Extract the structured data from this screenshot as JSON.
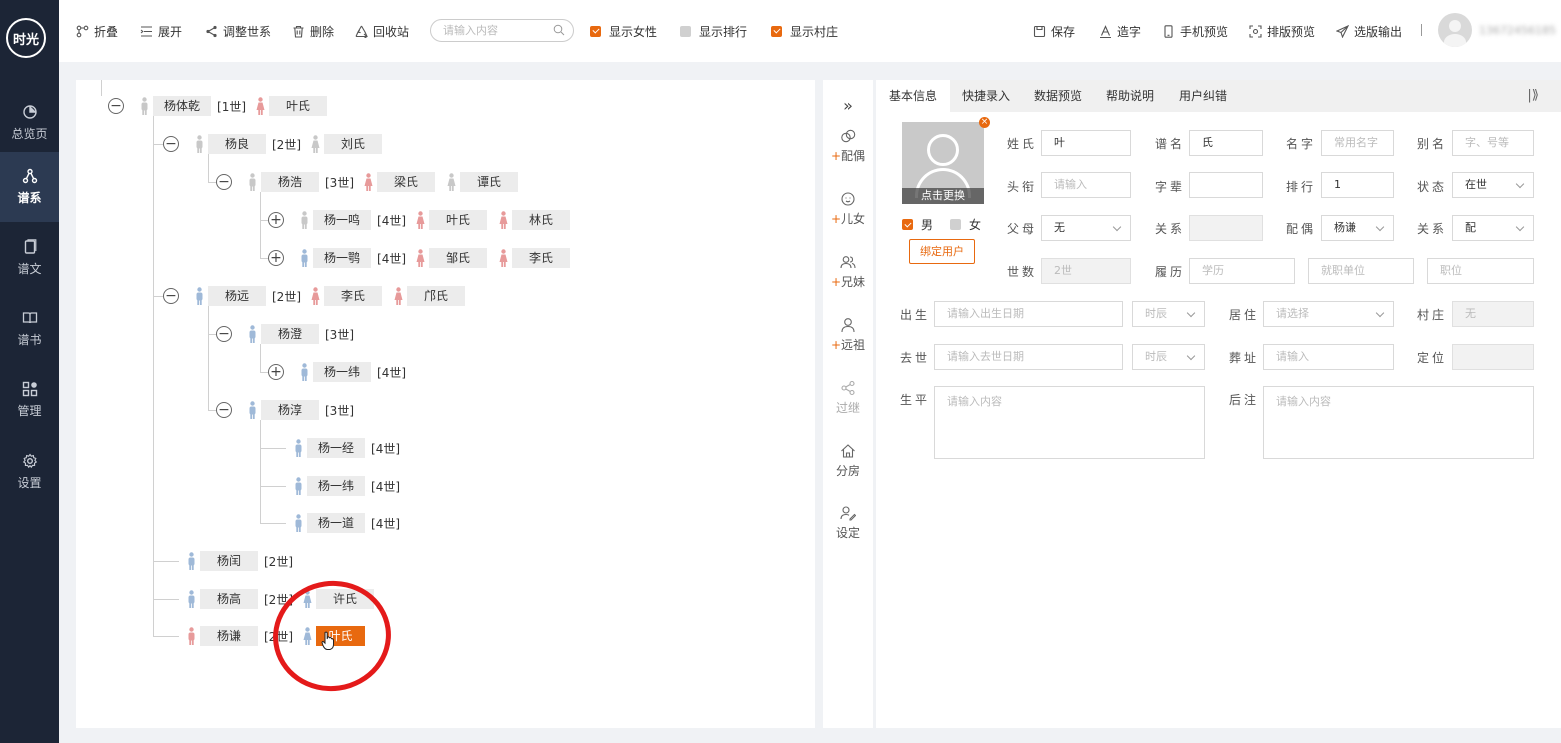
{
  "sidebar": {
    "logo": "时光",
    "items": [
      {
        "label": "总览页",
        "icon": "pie-chart-icon",
        "active": false
      },
      {
        "label": "谱系",
        "icon": "tree-icon",
        "active": true
      },
      {
        "label": "谱文",
        "icon": "document-icon",
        "active": false
      },
      {
        "label": "谱书",
        "icon": "book-icon",
        "active": false
      },
      {
        "label": "管理",
        "icon": "grid-icon",
        "active": false
      },
      {
        "label": "设置",
        "icon": "gear-icon",
        "active": false
      }
    ]
  },
  "toolbar": {
    "fold": "折叠",
    "expand": "展开",
    "adjust": "调整世系",
    "delete": "删除",
    "recycle": "回收站",
    "search_placeholder": "请输入内容",
    "show_female": "显示女性",
    "show_rank": "显示排行",
    "show_village": "显示村庄",
    "save": "保存",
    "create_char": "造字",
    "mobile_preview": "手机预览",
    "layout_preview": "排版预览",
    "export": "选版输出",
    "user_name": "13672456185",
    "colors": {
      "accent": "#e8690f",
      "sidebar_bg": "#1c2536"
    }
  },
  "tree": {
    "nodes": [
      {
        "name": "杨体乾",
        "gen": "[1世]",
        "spouses": [
          "叶氏"
        ]
      },
      {
        "name": "杨良",
        "gen": "[2世]",
        "spouses": [
          "刘氏"
        ]
      },
      {
        "name": "杨浩",
        "gen": "[3世]",
        "spouses": [
          "梁氏",
          "谭氏"
        ]
      },
      {
        "name": "杨一鸣",
        "gen": "[4世]",
        "spouses": [
          "叶氏",
          "林氏"
        ]
      },
      {
        "name": "杨一鹗",
        "gen": "[4世]",
        "spouses": [
          "邹氏",
          "李氏"
        ]
      },
      {
        "name": "杨远",
        "gen": "[2世]",
        "spouses": [
          "李氏",
          "邝氏"
        ]
      },
      {
        "name": "杨澄",
        "gen": "[3世]",
        "spouses": []
      },
      {
        "name": "杨一纬",
        "gen": "[4世]",
        "spouses": []
      },
      {
        "name": "杨淳",
        "gen": "[3世]",
        "spouses": []
      },
      {
        "name": "杨一经",
        "gen": "[4世]",
        "spouses": []
      },
      {
        "name": "杨一纬",
        "gen": "[4世]",
        "spouses": []
      },
      {
        "name": "杨一道",
        "gen": "[4世]",
        "spouses": []
      },
      {
        "name": "杨闰",
        "gen": "[2世]",
        "spouses": []
      },
      {
        "name": "杨高",
        "gen": "[2世]",
        "spouses": [
          "许氏"
        ]
      },
      {
        "name": "杨谦",
        "gen": "[2世]",
        "spouses": [
          "叶氏"
        ],
        "selected_spouse": "叶氏"
      }
    ]
  },
  "actions": {
    "spouse": "配偶",
    "children": "儿女",
    "siblings": "兄妹",
    "ancestor": "远祖",
    "adopt": "过继",
    "branch": "分房",
    "settle": "设定"
  },
  "form": {
    "tabs": [
      "基本信息",
      "快捷录入",
      "数据预览",
      "帮助说明",
      "用户纠错"
    ],
    "active_tab": "基本信息",
    "photo_caption": "点击更换",
    "gender_male": "男",
    "gender_female": "女",
    "bind_user": "绑定用户",
    "labels": {
      "surname": "姓氏",
      "pu_name": "谱名",
      "given_name": "名字",
      "alias": "别名",
      "title": "头衔",
      "zi_bei": "字辈",
      "rank": "排行",
      "status": "状态",
      "parents": "父母",
      "relation": "关系",
      "spouse": "配偶",
      "relation2": "关系",
      "generation": "世数",
      "resume": "履历",
      "birth": "出生",
      "residence": "居住",
      "village": "村庄",
      "death": "去世",
      "burial": "葬址",
      "locate": "定位",
      "life": "生平",
      "notes": "后注"
    },
    "values": {
      "surname": "叶",
      "pu_name": "氏",
      "given_name_ph": "常用名字",
      "alias_ph": "字、号等",
      "title_ph": "请输入",
      "zi_bei": "",
      "rank": "1",
      "status": "在世",
      "parents": "无",
      "relation": "",
      "spouse": "杨谦",
      "relation2": "配",
      "generation": "2世",
      "edu_ph": "学历",
      "work_ph": "就职单位",
      "post_ph": "职位",
      "birth_ph": "请输入出生日期",
      "birth_hour_ph": "时辰",
      "residence_ph": "请选择",
      "village": "无",
      "death_ph": "请输入去世日期",
      "death_hour_ph": "时辰",
      "burial_ph": "请输入",
      "locate": "",
      "life_ph": "请输入内容",
      "notes_ph": "请输入内容"
    }
  }
}
